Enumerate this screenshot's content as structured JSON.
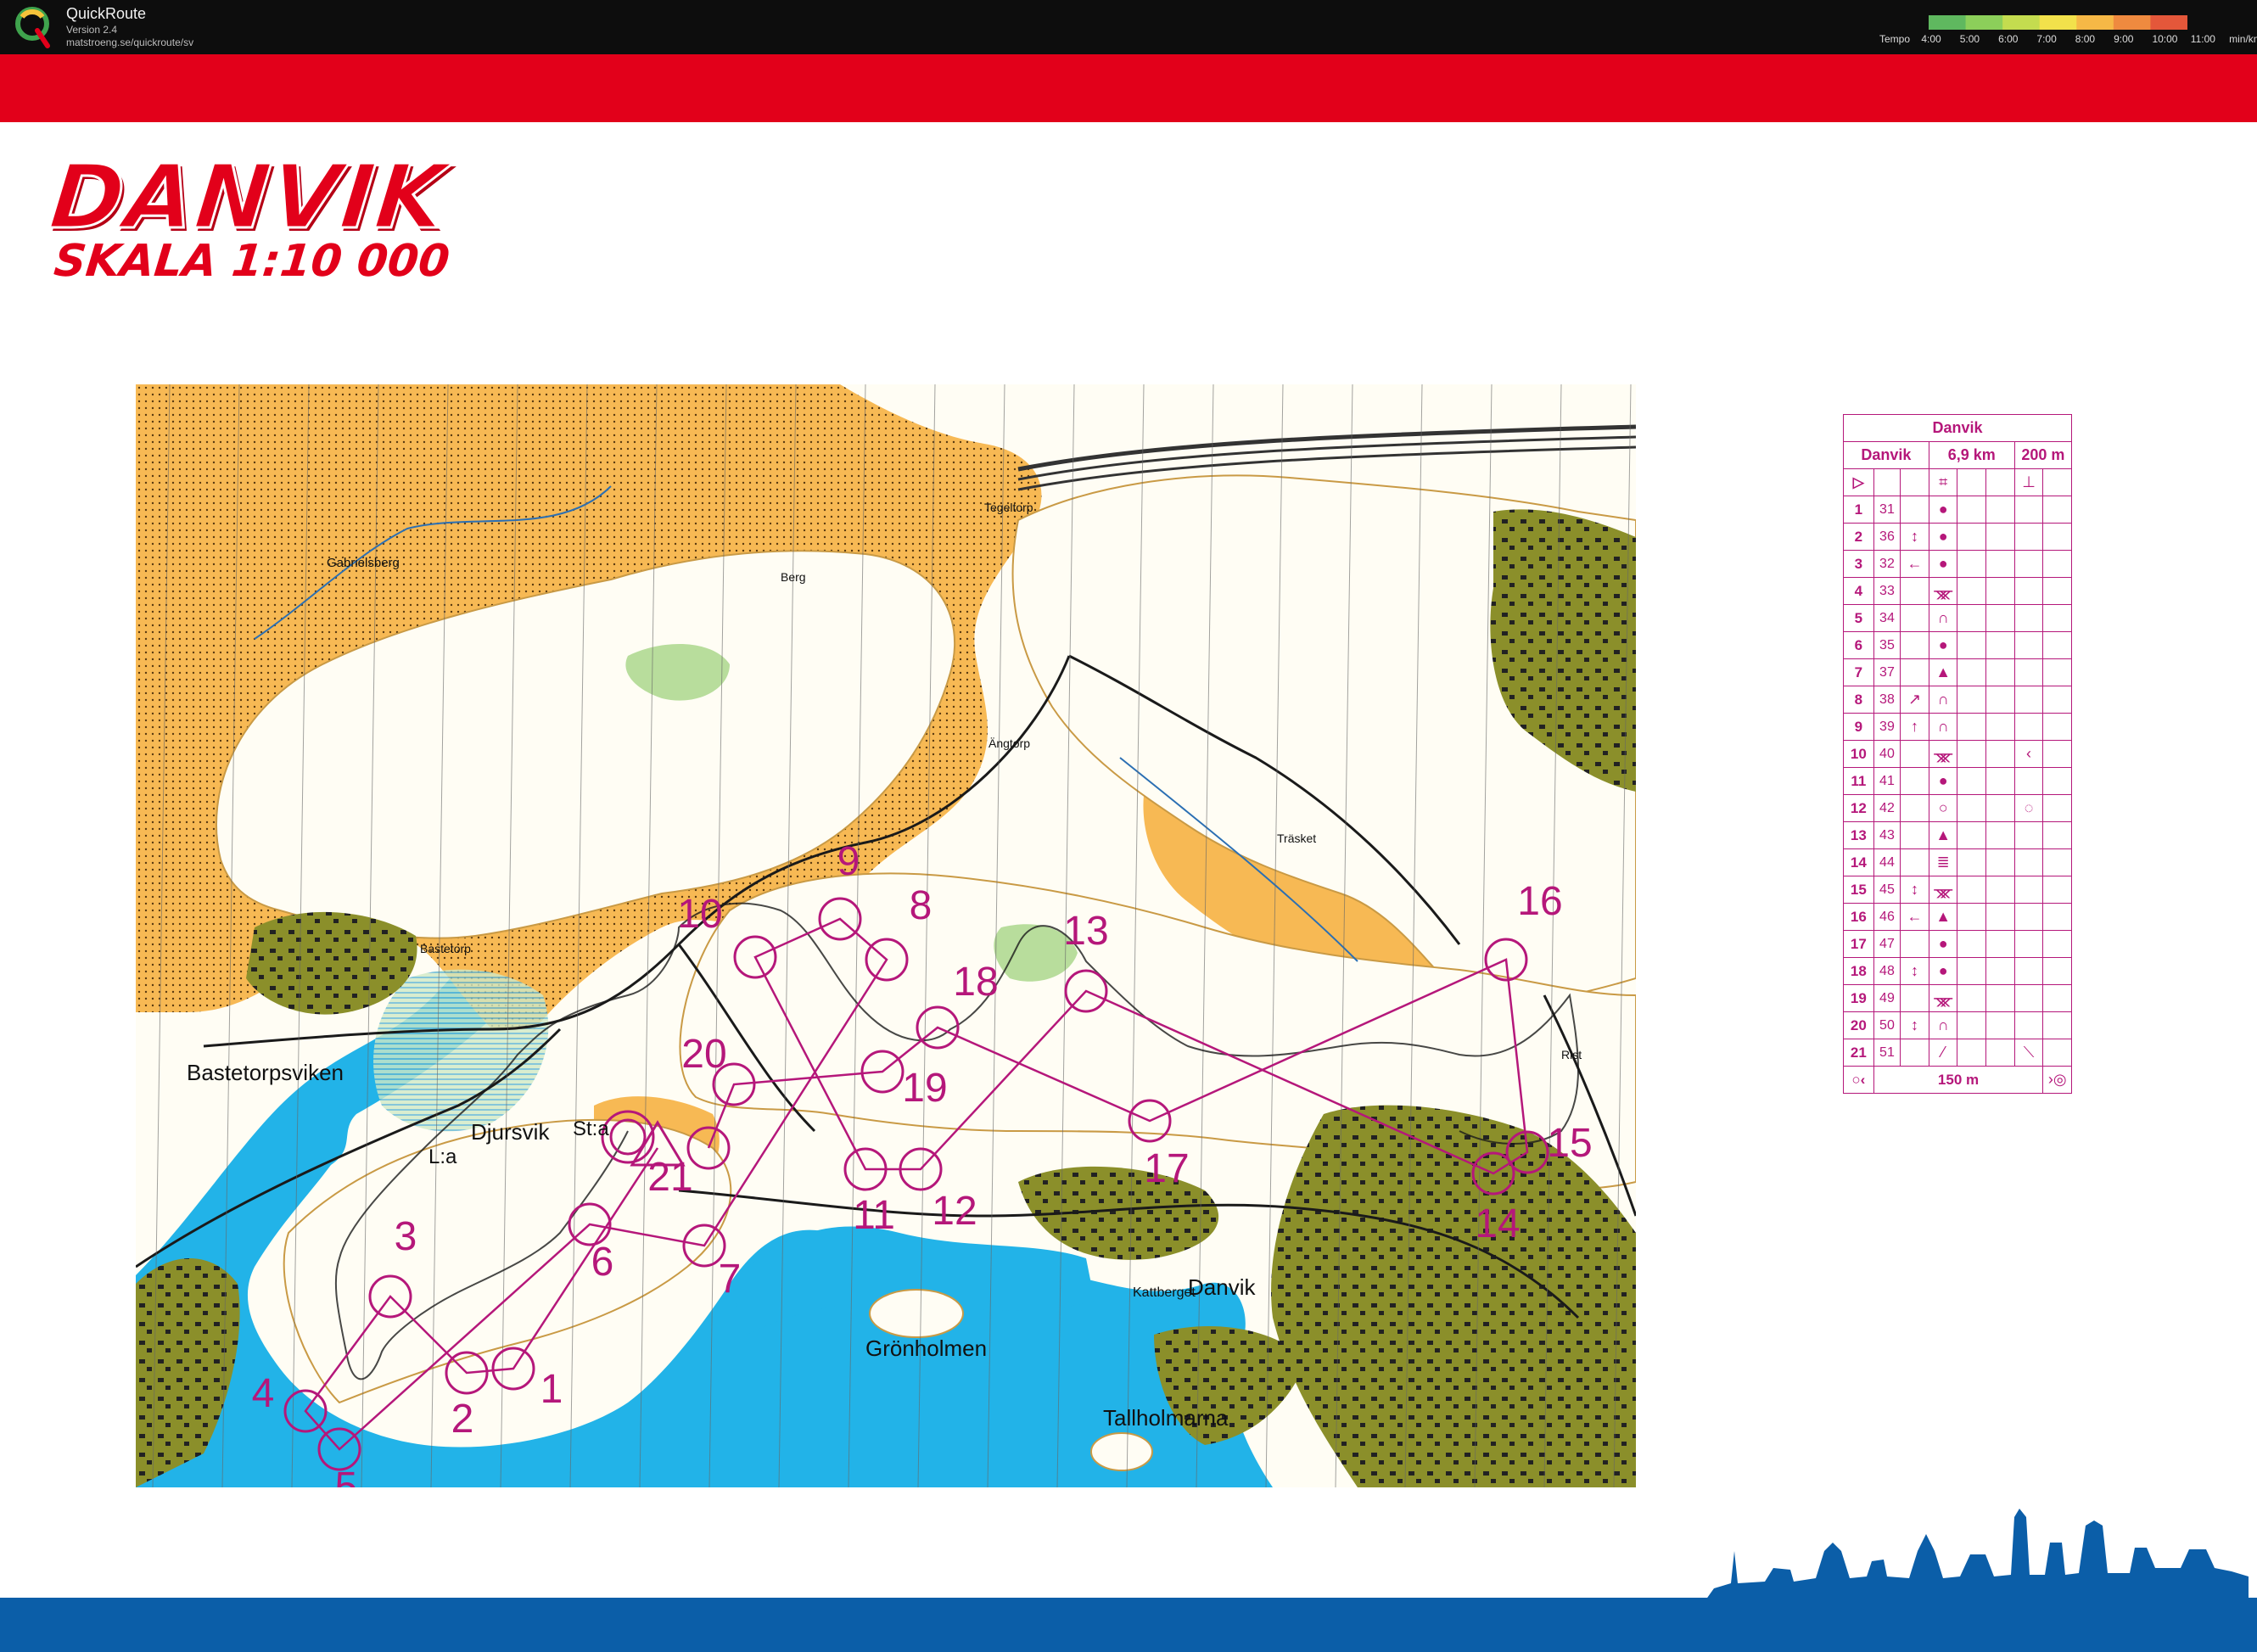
{
  "app": {
    "title": "QuickRoute",
    "version": "Version 2.4",
    "url": "matstroeng.se/quickroute/sv"
  },
  "tempo": {
    "label": "Tempo",
    "ticks": [
      "4:00",
      "5:00",
      "6:00",
      "7:00",
      "8:00",
      "9:00",
      "10:00",
      "11:00"
    ],
    "unit": "min/km",
    "colors": [
      "#5fb85f",
      "#8ccf5a",
      "#c4dc4f",
      "#f2e14b",
      "#f6b846",
      "#ef8a3f",
      "#e4573a"
    ]
  },
  "map": {
    "title": "DANVIK",
    "scale": "SKALA 1:10 000",
    "places": [
      "Bastetorpsviken",
      "Djursvik",
      "L:a",
      "St:a",
      "Grönholmen",
      "Danvik",
      "Tallholmarna",
      "Kattberget",
      "Gabrielsberg",
      "Bastetorp",
      "Tegeltorp",
      "Berg",
      "Ängtorp",
      "Träsket",
      "Rist"
    ],
    "controls": [
      "1",
      "2",
      "3",
      "4",
      "5",
      "6",
      "7",
      "8",
      "9",
      "10",
      "11",
      "12",
      "13",
      "14",
      "15",
      "16",
      "17",
      "18",
      "19",
      "20",
      "21"
    ],
    "colors": {
      "course": "#b5177a",
      "water": "#22b3e8",
      "open": "#f7b954",
      "forest": "#ffffff",
      "green": "#8b8f2a",
      "route": "#1a1a1a"
    }
  },
  "control_description": {
    "header": "Danvik",
    "course": "Danvik",
    "length": "6,9 km",
    "climb": "200 m",
    "start_symbol": "▷",
    "rows": [
      {
        "n": "1",
        "code": "31",
        "c": "",
        "d": "●",
        "g": ""
      },
      {
        "n": "2",
        "code": "36",
        "c": "↕",
        "d": "●",
        "g": ""
      },
      {
        "n": "3",
        "code": "32",
        "c": "←",
        "d": "●",
        "g": ""
      },
      {
        "n": "4",
        "code": "33",
        "c": "",
        "d": "ᚘ",
        "g": ""
      },
      {
        "n": "5",
        "code": "34",
        "c": "",
        "d": "∩",
        "g": ""
      },
      {
        "n": "6",
        "code": "35",
        "c": "",
        "d": "●",
        "g": ""
      },
      {
        "n": "7",
        "code": "37",
        "c": "",
        "d": "▲",
        "g": ""
      },
      {
        "n": "8",
        "code": "38",
        "c": "↗",
        "d": "∩",
        "g": ""
      },
      {
        "n": "9",
        "code": "39",
        "c": "↑",
        "d": "∩",
        "g": ""
      },
      {
        "n": "10",
        "code": "40",
        "c": "",
        "d": "ᚘ",
        "g": "‹"
      },
      {
        "n": "11",
        "code": "41",
        "c": "",
        "d": "●",
        "g": ""
      },
      {
        "n": "12",
        "code": "42",
        "c": "",
        "d": "○",
        "g": "◌"
      },
      {
        "n": "13",
        "code": "43",
        "c": "",
        "d": "▲",
        "g": ""
      },
      {
        "n": "14",
        "code": "44",
        "c": "",
        "d": "≣",
        "g": ""
      },
      {
        "n": "15",
        "code": "45",
        "c": "↕",
        "d": "ᚘ",
        "g": ""
      },
      {
        "n": "16",
        "code": "46",
        "c": "←",
        "d": "▲",
        "g": ""
      },
      {
        "n": "17",
        "code": "47",
        "c": "",
        "d": "●",
        "g": ""
      },
      {
        "n": "18",
        "code": "48",
        "c": "↕",
        "d": "●",
        "g": ""
      },
      {
        "n": "19",
        "code": "49",
        "c": "",
        "d": "ᚘ",
        "g": ""
      },
      {
        "n": "20",
        "code": "50",
        "c": "↕",
        "d": "∩",
        "g": ""
      },
      {
        "n": "21",
        "code": "51",
        "c": "",
        "d": "⁄",
        "g": "⟍"
      }
    ],
    "finish_distance": "150 m"
  }
}
